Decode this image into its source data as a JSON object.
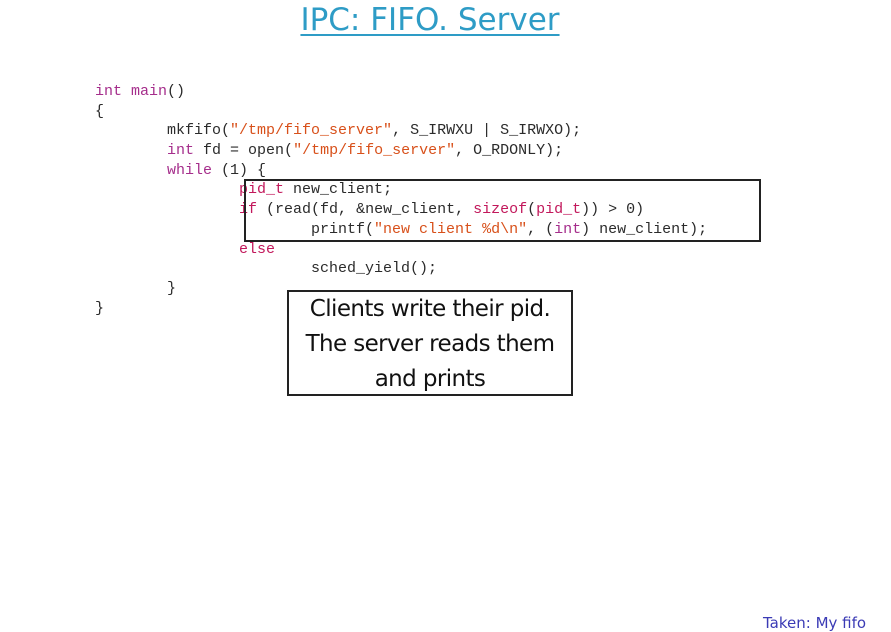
{
  "slide": {
    "title": "IPC: FIFO. Server"
  },
  "code": {
    "l1": {
      "t1": "int",
      "t2": " ",
      "t3": "main",
      "t4": "()"
    },
    "l2": {
      "t1": "{"
    },
    "l3": {
      "t1": "        mkfifo(",
      "t2": "\"/tmp/fifo_server\"",
      "t3": ", S_IRWXU | S_IRWXO);"
    },
    "l4": {
      "t1": "        ",
      "t2": "int",
      "t3": " fd = open(",
      "t4": "\"/tmp/fifo_server\"",
      "t5": ", O_RDONLY);"
    },
    "l5": {
      "t1": "        ",
      "t2": "while",
      "t3": " (1) {"
    },
    "l6": {
      "t1": "                ",
      "t2": "pid_t",
      "t3": " new_client;"
    },
    "l7": {
      "t1": "                ",
      "t2": "if",
      "t3": " (read(fd, &new_client, ",
      "t4": "sizeof",
      "t5": "(",
      "t6": "pid_t",
      "t7": ")) > 0)"
    },
    "l8": {
      "t1": "                        printf(",
      "t2": "\"new client %d\\n\"",
      "t3": ", (",
      "t4": "int",
      "t5": ") new_client);"
    },
    "l9": {
      "t1": "                ",
      "t2": "else"
    },
    "l10": {
      "t1": "                        sched_yield();"
    },
    "l11": {
      "t1": "        }"
    },
    "l12": {
      "t1": "}"
    }
  },
  "callout": {
    "line1": "Clients write their pid.",
    "line2": "The server reads them",
    "line3": "and prints"
  },
  "footer": {
    "link_text": "Taken: My fifo"
  }
}
